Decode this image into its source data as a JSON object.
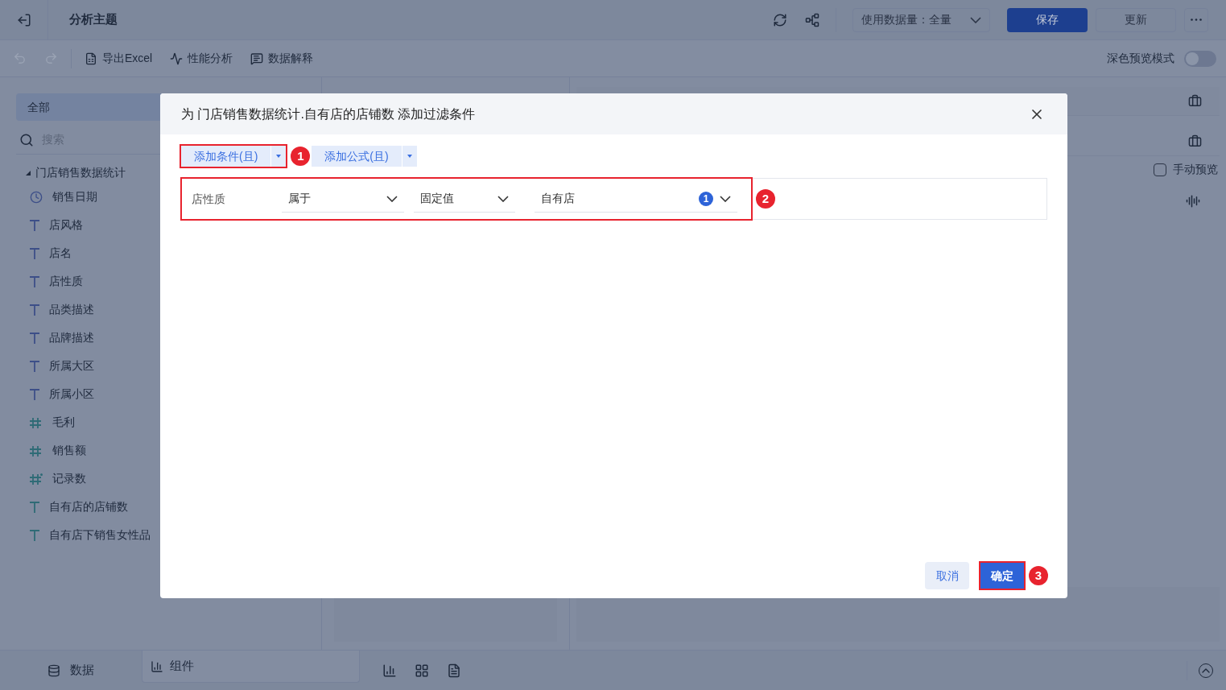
{
  "header": {
    "title": "分析主题",
    "data_volume": {
      "label": "使用数据量：",
      "value": "全量"
    },
    "buttons": [
      {
        "label": "保存",
        "kind": "primary"
      },
      {
        "label": "更新",
        "kind": "secondary"
      }
    ]
  },
  "toolbar": {
    "items": [
      {
        "label": "导出Excel",
        "kind": "excel"
      },
      {
        "label": "性能分析",
        "kind": "performance"
      },
      {
        "label": "数据解释",
        "kind": "explain"
      }
    ],
    "dark_mode": {
      "label": "深色预览模式",
      "on": false
    }
  },
  "sidebar": {
    "tab": "全部",
    "search_placeholder": "搜索",
    "dataset": {
      "name": "门店销售数据统计",
      "expanded": true,
      "fields": [
        {
          "name": "销售日期",
          "kind": "date"
        },
        {
          "name": "店风格",
          "kind": "text"
        },
        {
          "name": "店名",
          "kind": "text"
        },
        {
          "name": "店性质",
          "kind": "text"
        },
        {
          "name": "品类描述",
          "kind": "text"
        },
        {
          "name": "品牌描述",
          "kind": "text"
        },
        {
          "name": "所属大区",
          "kind": "text"
        },
        {
          "name": "所属小区",
          "kind": "text"
        },
        {
          "name": "毛利",
          "kind": "number"
        },
        {
          "name": "销售额",
          "kind": "number"
        },
        {
          "name": "记录数",
          "kind": "count"
        },
        {
          "name": "自有店的店铺数",
          "kind": "calc"
        },
        {
          "name": "自有店下销售女性品",
          "kind": "calc"
        }
      ]
    }
  },
  "right_panel": {
    "manual_preview": {
      "label": "手动预览",
      "checked": false
    }
  },
  "bottom_tabs": [
    {
      "label": "数据",
      "kind": "data"
    },
    {
      "label": "组件",
      "kind": "component"
    }
  ],
  "dialog": {
    "title": "为 门店销售数据统计.自有店的店铺数 添加过滤条件",
    "add_buttons": [
      {
        "label": "添加条件(且)",
        "marker": "1"
      },
      {
        "label": "添加公式(且)"
      }
    ],
    "condition": {
      "field": "店性质",
      "operator": "属于",
      "value_type": "固定值",
      "value": "自有店",
      "count": "1",
      "marker": "2"
    },
    "cancel": {
      "label": "取消"
    },
    "confirm": {
      "label": "确定",
      "marker": "3"
    }
  }
}
